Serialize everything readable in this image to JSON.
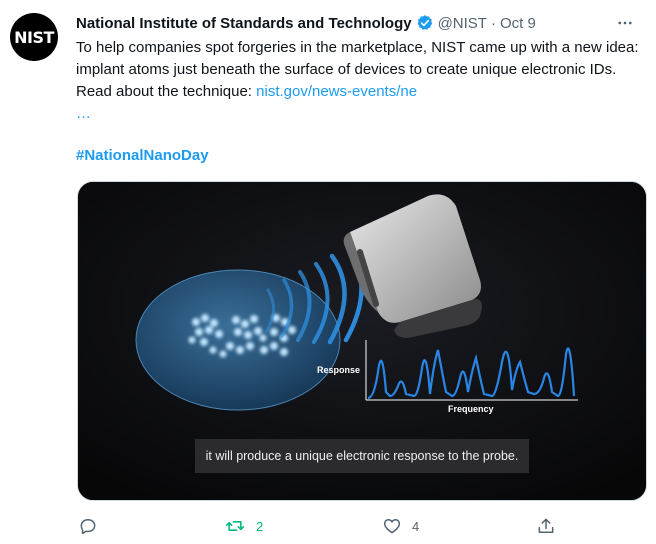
{
  "author": {
    "avatar_text": "NIST",
    "name": "National Institute of Standards and Technology",
    "handle": "@NIST",
    "separator": "·",
    "date": "Oct 9"
  },
  "tweet": {
    "text": "To help companies spot forgeries in the marketplace, NIST came up with a new idea: implant atoms just beneath the surface of devices to create unique electronic IDs. Read about the technique: ",
    "link_text": "nist.gov/news-events/ne",
    "link_ellipsis": "…",
    "hashtag": "#NationalNanoDay"
  },
  "media": {
    "caption": "it will produce a unique electronic response to the probe.",
    "response_label": "Response",
    "frequency_label": "Frequency"
  },
  "actions": {
    "reply_count": "",
    "retweet_count": "2",
    "like_count": "4"
  },
  "colors": {
    "link": "#1d9bf0",
    "retweet": "#00ba7c",
    "secondary": "#536471"
  }
}
